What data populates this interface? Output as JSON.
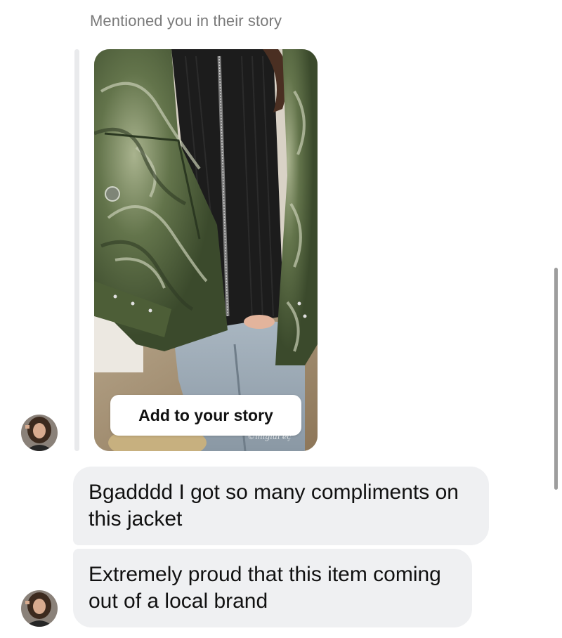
{
  "story_mention": {
    "caption": "Mentioned you in their story",
    "add_to_story_label": "Add to your story",
    "watermark": "©ınıgıuı éç"
  },
  "messages": [
    {
      "text": "Bgadddd I got so many compliments on this jacket"
    },
    {
      "text": "Extremely proud that this item coming out of a local brand"
    }
  ],
  "icons": {
    "avatar": "profile-photo",
    "story": "story-photo"
  },
  "colors": {
    "bubble_background": "#eff0f2",
    "caption_gray": "#7a7a7a",
    "jacket_green": "#55663f"
  }
}
